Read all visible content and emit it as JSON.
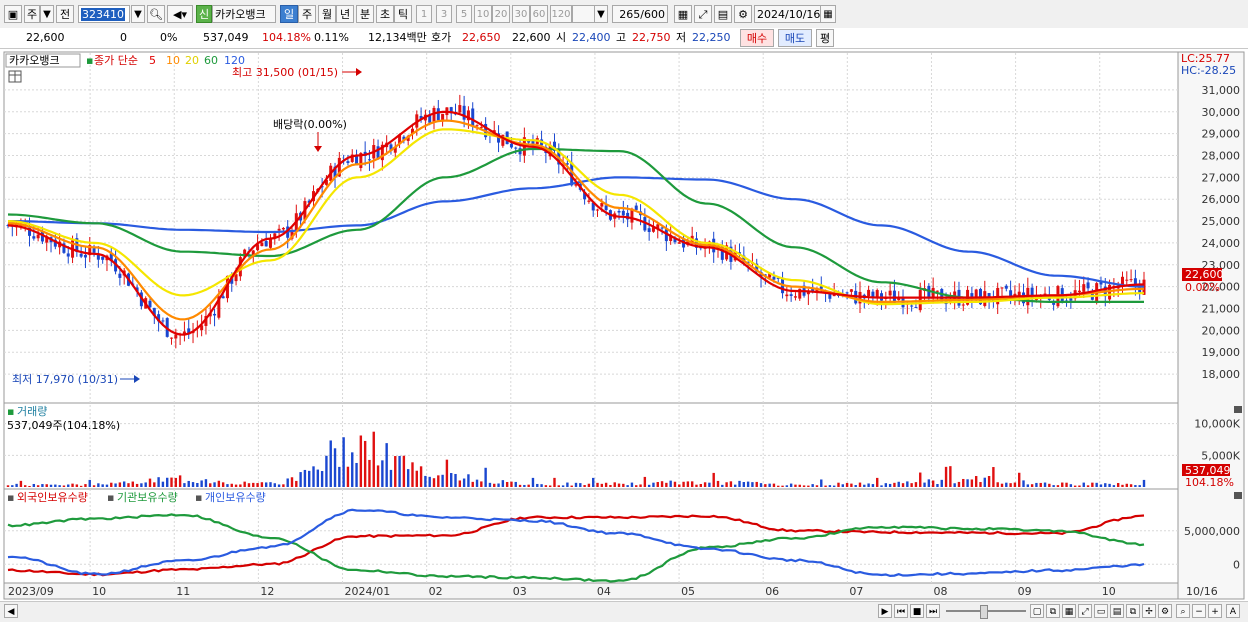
{
  "toolbar": {
    "period_label": "주",
    "prev_label": "전",
    "stock_code": "323410",
    "stock_name": "카카오뱅크",
    "new_label": "신",
    "periods": [
      "일",
      "주",
      "월",
      "년",
      "분",
      "초",
      "틱"
    ],
    "active_period": "일",
    "intervals": [
      "1",
      "3",
      "5",
      "10",
      "20",
      "30",
      "60",
      "120"
    ],
    "count_value": "265",
    "count_total": "/600",
    "date_value": "2024/10/16"
  },
  "info": {
    "price": "22,600",
    "change": "0",
    "change_pct": "0%",
    "volume": "537,049",
    "volume_pct": "104.18%",
    "turnover_pct": "0.11%",
    "amount": "12,134백만",
    "ask_label": "호가",
    "ask": "22,650",
    "bid": "22,600",
    "open_label": "시",
    "open": "22,400",
    "high_label": "고",
    "high": "22,750",
    "low_label": "저",
    "low": "22,250",
    "buy_label": "매수",
    "sell_label": "매도",
    "avg_label": "평"
  },
  "legend": {
    "stock": "카카오뱅크",
    "ma_prefix": "종가 단순",
    "ma": [
      "5",
      "10",
      "20",
      "60",
      "120"
    ],
    "ma_colors": [
      "#e00000",
      "#ff8a00",
      "#f5e600",
      "#1e9a3c",
      "#2a5be0"
    ]
  },
  "annotations": {
    "high": "최고 31,500 (01/15)",
    "low": "최저 17,970 (10/31)",
    "dividend": "배당락(0.00%)",
    "lc": "LC:25.77",
    "hc": "HC:-28.25",
    "current_price": "22,600",
    "current_pct": "0.00%"
  },
  "volume_panel": {
    "title": "거래량",
    "value": "537,049주(104.18%)",
    "current": "537,049",
    "current_pct": "104.18%"
  },
  "holdings_panel": {
    "foreign": "외국인보유수량",
    "institution": "기관보유수량",
    "individual": "개인보유수량"
  },
  "x_labels": [
    "2023/09",
    "10",
    "11",
    "12",
    "2024/01",
    "02",
    "03",
    "04",
    "05",
    "06",
    "07",
    "08",
    "09",
    "10",
    "10/16"
  ],
  "price_axis": [
    "31,000",
    "30,000",
    "29,000",
    "28,000",
    "27,000",
    "26,000",
    "25,000",
    "24,000",
    "23,000",
    "22,000",
    "21,000",
    "20,000",
    "19,000",
    "18,000"
  ],
  "volume_axis": [
    "10,000K",
    "5,000K"
  ],
  "holdings_axis": [
    "5,000,000",
    "0"
  ],
  "chart_data": [
    {
      "type": "line",
      "title": "카카오뱅크",
      "x": [
        "2023/09",
        "10",
        "11",
        "12",
        "2024/01",
        "02",
        "03",
        "04",
        "05",
        "06",
        "07",
        "08",
        "09",
        "10"
      ],
      "series": [
        {
          "name": "5",
          "values": [
            24800,
            23500,
            19800,
            24200,
            28000,
            30000,
            28400,
            25200,
            23800,
            21800,
            21500,
            21500,
            21600,
            22100
          ]
        },
        {
          "name": "10",
          "values": [
            24900,
            23800,
            20500,
            23700,
            27600,
            29600,
            28500,
            25600,
            23900,
            22000,
            21300,
            21400,
            21600,
            21900
          ]
        },
        {
          "name": "20",
          "values": [
            25000,
            24000,
            21600,
            23200,
            27000,
            29200,
            28700,
            26200,
            24000,
            22300,
            21200,
            21300,
            21500,
            21700
          ]
        },
        {
          "name": "60",
          "values": [
            25300,
            24900,
            23600,
            23400,
            24600,
            27000,
            28300,
            28200,
            25800,
            23800,
            22200,
            21500,
            21300,
            21300
          ]
        },
        {
          "name": "120",
          "values": [
            25000,
            24900,
            24600,
            24500,
            24800,
            25900,
            26500,
            27000,
            26900,
            26000,
            24800,
            23600,
            22500,
            22000
          ]
        }
      ],
      "ylim": [
        17500,
        31500
      ]
    },
    {
      "type": "bar",
      "title": "거래량",
      "x": [
        "2023/09",
        "10",
        "11",
        "12",
        "2024/01",
        "02",
        "03",
        "04",
        "05",
        "06",
        "07",
        "08",
        "09",
        "10"
      ],
      "values": [
        600,
        700,
        2200,
        900,
        11800,
        2700,
        900,
        900,
        1400,
        700,
        900,
        2200,
        900,
        700
      ],
      "ylim": [
        0,
        12000
      ]
    },
    {
      "type": "line",
      "title": "보유수량",
      "x": [
        "2023/09",
        "10",
        "11",
        "12",
        "2024/01",
        "02",
        "03",
        "04",
        "05",
        "06",
        "07",
        "08",
        "09",
        "10"
      ],
      "series": [
        {
          "name": "외국인보유수량",
          "values": [
            -900000,
            -1500000,
            -800000,
            0,
            4200000,
            4300000,
            7000000,
            7000000,
            7200000,
            5000000,
            4800000,
            4700000,
            4600000,
            7200000
          ]
        },
        {
          "name": "기관보유수량",
          "values": [
            5800000,
            6800000,
            7400000,
            4000000,
            -900000,
            -1800000,
            -2000000,
            -2500000,
            2500000,
            3900000,
            5600000,
            5300000,
            5000000,
            3000000
          ]
        },
        {
          "name": "개인보유수량",
          "values": [
            1200000,
            -1500000,
            500000,
            2600000,
            8100000,
            7000000,
            6500000,
            4600000,
            2300000,
            600000,
            -1600000,
            -1400000,
            -900000,
            -100000
          ]
        }
      ],
      "ylim": [
        -2500000,
        9000000
      ]
    }
  ]
}
